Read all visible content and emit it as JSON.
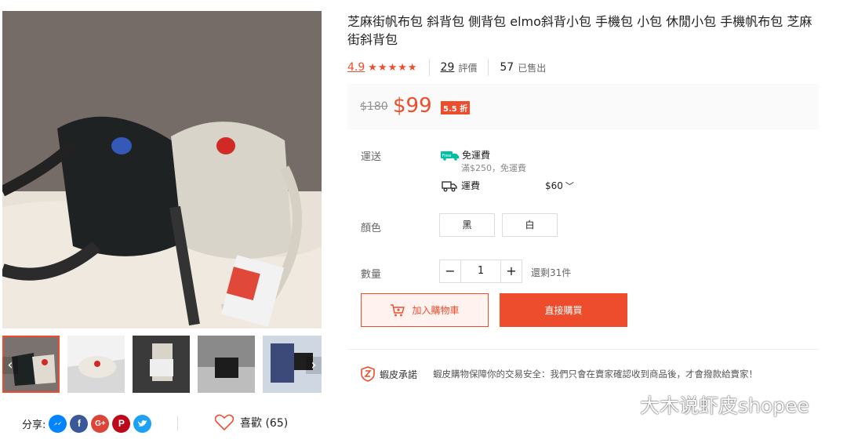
{
  "product": {
    "title": "芝麻街帆布包 斜背包 側背包 elmo斜背小包 手機包 小包 休閒小包 手機帆布包 芝麻街斜背包"
  },
  "ratings": {
    "score": "4.9",
    "stars": "★★★★★",
    "reviews_count": "29",
    "reviews_label": "評價",
    "sold_count": "57",
    "sold_label": "已售出"
  },
  "price": {
    "original": "$180",
    "current": "$99",
    "discount": "5.5 折"
  },
  "shipping": {
    "label": "運送",
    "free_title": "免運費",
    "free_badge": "Free",
    "free_condition": "滿$250，免運費",
    "fee_label": "運費",
    "fee_value": "$60",
    "chevron": "﹀"
  },
  "color": {
    "label": "顏色",
    "options": [
      "黑",
      "白"
    ]
  },
  "quantity": {
    "label": "數量",
    "minus": "−",
    "value": "1",
    "plus": "+",
    "stock": "還剩31件"
  },
  "actions": {
    "add_to_cart": "加入購物車",
    "buy_now": "直接購買"
  },
  "guarantee": {
    "title": "蝦皮承諾",
    "text": "蝦皮購物保障你的交易安全：我們只會在賣家確認收到商品後，才會撥款給賣家！"
  },
  "share": {
    "label": "分享:",
    "networks": [
      "messenger-icon",
      "facebook-icon",
      "google-plus-icon",
      "pinterest-icon",
      "twitter-icon"
    ]
  },
  "like": {
    "label": "喜歡 (65)"
  },
  "thumbnails": {
    "prev": "‹",
    "next": "›"
  },
  "watermark": "大木说虾皮shopee",
  "colors": {
    "accent": "#ee4d2d",
    "messenger": "#0084ff",
    "facebook": "#3b5998",
    "google": "#db4437",
    "pinterest": "#bd081c",
    "twitter": "#1da1f2"
  }
}
